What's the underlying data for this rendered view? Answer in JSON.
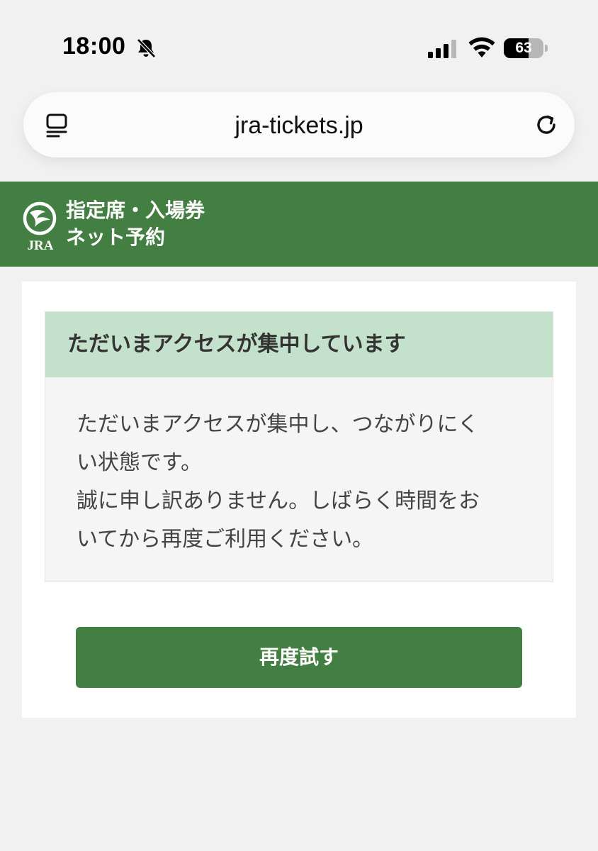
{
  "status_bar": {
    "time": "18:00",
    "battery_percent": 63,
    "battery_label": "63",
    "icons": [
      "bell-slash-icon",
      "cellular-signal-icon",
      "wifi-icon",
      "battery-icon"
    ]
  },
  "browser": {
    "url": "jra-tickets.jp",
    "left_icon": "tabs-icon",
    "right_icon": "reload-icon"
  },
  "header": {
    "logo_text": "JRA",
    "title_line1": "指定席・入場券",
    "title_line2": "ネット予約",
    "background_color": "#437f42"
  },
  "notice": {
    "heading": "ただいまアクセスが集中しています",
    "body_line1": "ただいまアクセスが集中し、つながりにく",
    "body_line2": "い状態です。",
    "body_line3": "誠に申し訳ありません。しばらく時間をお",
    "body_line4": "いてから再度ご利用ください。",
    "heading_background": "#c4e2cb"
  },
  "actions": {
    "retry_label": "再度試す",
    "accent_color": "#437f42"
  }
}
